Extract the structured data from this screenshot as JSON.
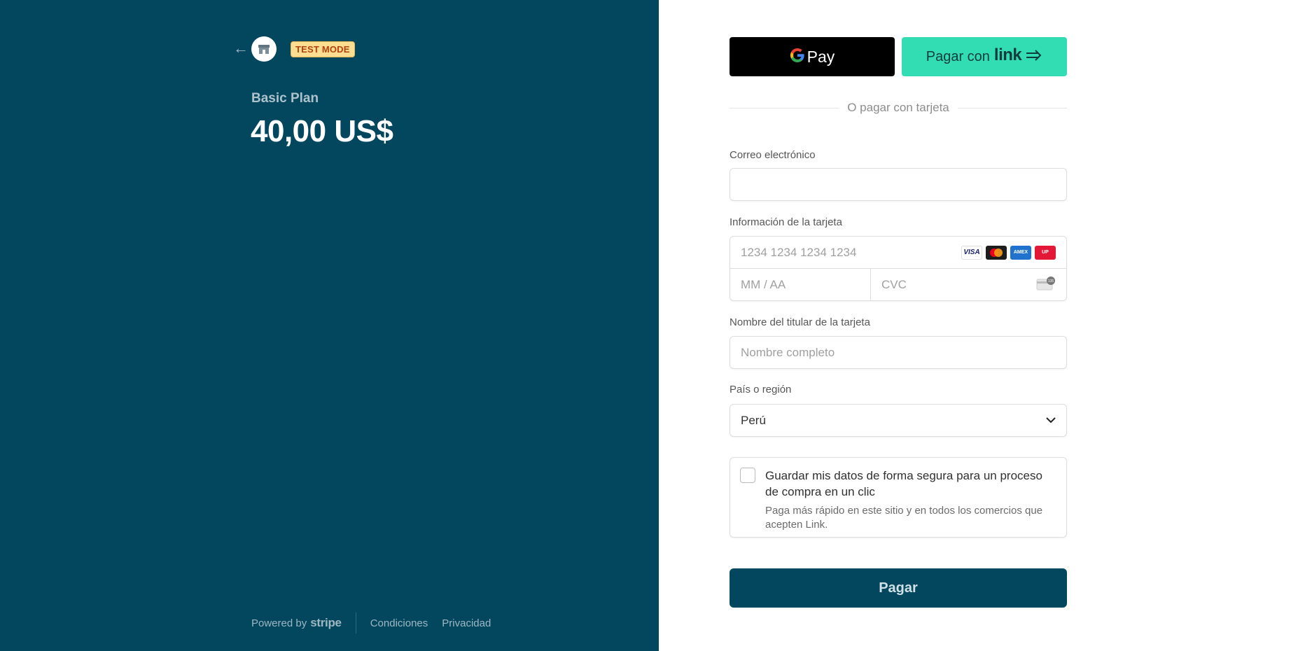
{
  "summary": {
    "back_icon": "arrow-left-icon",
    "store_icon": "store-icon",
    "badge": "TEST MODE",
    "product_name": "Basic Plan",
    "price": "40,00 US$"
  },
  "footer": {
    "powered_by": "Powered by",
    "stripe": "stripe",
    "terms": "Condiciones",
    "privacy": "Privacidad"
  },
  "wallets": {
    "gpay_label": "Pay",
    "link_text": "Pagar con",
    "link_logo": "link",
    "divider": "O pagar con tarjeta"
  },
  "form": {
    "email_label": "Correo electrónico",
    "email_value": "",
    "card_label": "Información de la tarjeta",
    "card_number_placeholder": "1234 1234 1234 1234",
    "expiry_placeholder": "MM / AA",
    "cvc_placeholder": "CVC",
    "brands": [
      "VISA",
      "Mastercard",
      "AMEX",
      "UnionPay"
    ],
    "cvc_badge": "135",
    "name_label": "Nombre del titular de la tarjeta",
    "name_placeholder": "Nombre completo",
    "country_label": "País o región",
    "country_value": "Perú",
    "save_title": "Guardar mis datos de forma segura para un proceso de compra en un clic",
    "save_desc": "Paga más rápido en este sitio y en todos los comercios que acepten Link.",
    "save_checked": false,
    "pay_button": "Pagar"
  },
  "colors": {
    "panel": "#03475f",
    "link_green": "#33ddb3",
    "badge_bg": "#ffde92",
    "badge_text": "#b3420c"
  }
}
